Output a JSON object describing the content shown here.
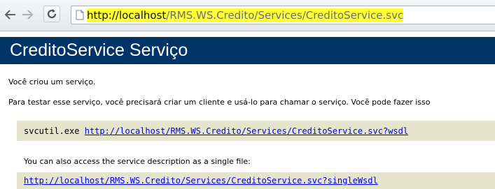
{
  "browser": {
    "back_icon": "back-arrow-icon",
    "forward_icon": "forward-arrow-icon",
    "reload_icon": "reload-icon",
    "url_scheme_host": "http://localhost",
    "url_path": "/RMS.WS.Credito/Services/CreditoService.svc",
    "url_highlight_color": "#ffff33"
  },
  "page": {
    "title": "CreditoService Serviço",
    "header_color": "#003366",
    "intro": "Você criou um serviço.",
    "instructions": "Para testar esse serviço, você precisará criar um cliente e usá-lo para chamar o serviço. Você pode fazer isso",
    "svcutil_command": "svcutil.exe",
    "wsdl_link": "http://localhost/RMS.WS.Credito/Services/CreditoService.svc?wsdl",
    "single_file_text": "You can also access the service description as a single file:",
    "single_wsdl_link": "http://localhost/RMS.WS.Credito/Services/CreditoService.svc?singleWsdl",
    "code_bg_color": "#e5e5cc"
  }
}
